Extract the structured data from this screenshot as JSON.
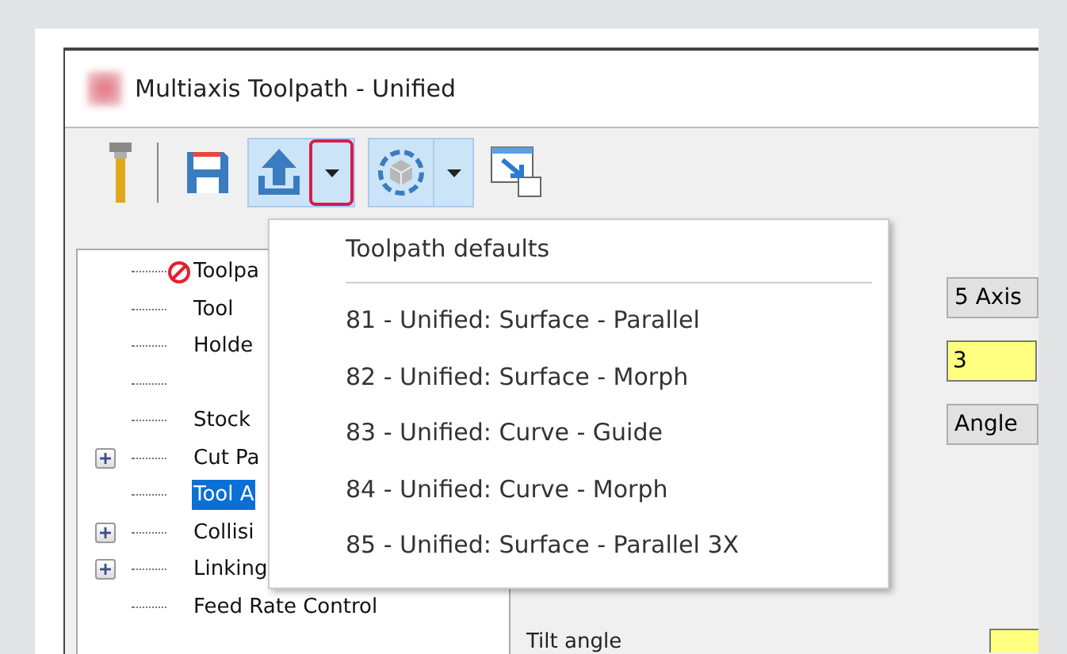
{
  "window": {
    "title": "Multiaxis Toolpath - Unified"
  },
  "toolbar": [
    {
      "kind": "tool"
    },
    {
      "kind": "separator"
    },
    {
      "kind": "save"
    },
    {
      "kind": "upload",
      "pressed": true,
      "caret_highlighted": true
    },
    {
      "kind": "view",
      "pressed": true,
      "caret_highlighted": false
    },
    {
      "kind": "resize"
    }
  ],
  "menu": {
    "title": "Toolpath defaults",
    "items": [
      "81 - Unified: Surface - Parallel",
      "82 - Unified: Surface - Morph",
      "83 - Unified: Curve - Guide",
      "84 - Unified: Curve - Morph",
      "85 - Unified: Surface - Parallel 3X"
    ]
  },
  "tree": [
    {
      "label": "Toolpa",
      "error": true,
      "selected": false
    },
    {
      "label": "Tool",
      "selected": false
    },
    {
      "label": "Holde",
      "selected": false
    },
    {
      "selected": false
    },
    {
      "label": "Stock",
      "selected": false
    },
    {
      "label": "Cut Pa",
      "expanded": false,
      "selected": false
    },
    {
      "label": "Tool A",
      "selected": true
    },
    {
      "label": "Collisi",
      "expanded": false,
      "selected": false
    },
    {
      "label": "Linking",
      "expanded": false,
      "selected": false
    },
    {
      "label": "Feed Rate Control",
      "selected": false
    }
  ],
  "controls": [
    {
      "kind": "button",
      "label": "5 Axis"
    },
    {
      "kind": "field",
      "value": "3"
    },
    {
      "kind": "button",
      "label": "Angle"
    }
  ],
  "tilt": {
    "label": "Tilt angle"
  }
}
